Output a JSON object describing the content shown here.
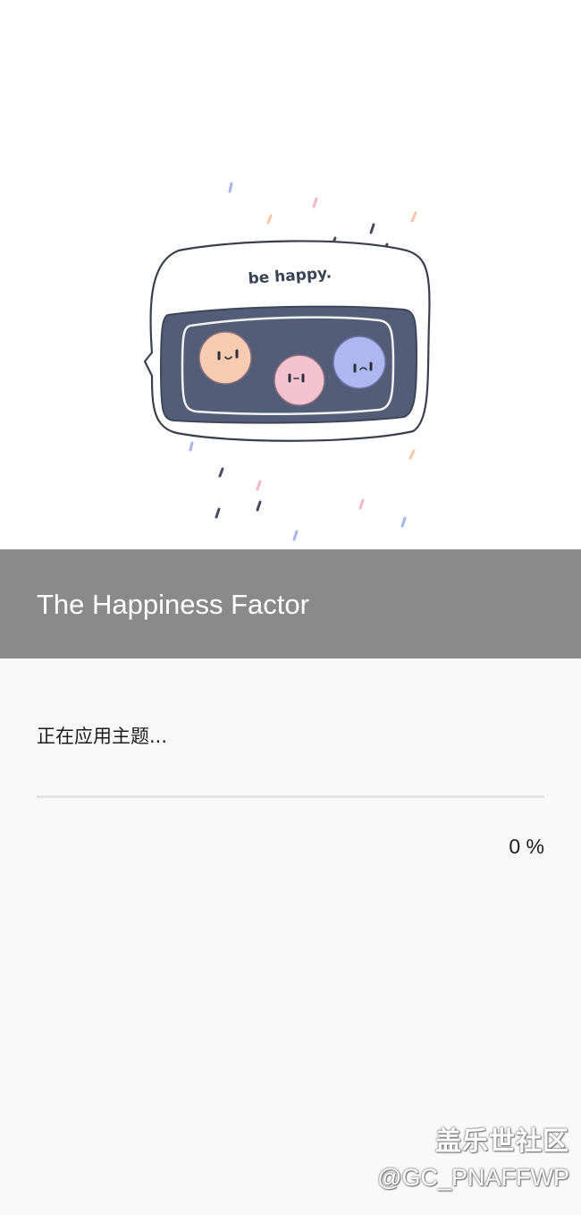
{
  "theme": {
    "title": "The Happiness Factor",
    "illustration_text": "be happy."
  },
  "apply": {
    "status": "正在应用主题...",
    "progress_percent": 0,
    "percent_label": "0 %"
  },
  "watermark": {
    "line1": "盖乐世社区",
    "line2": "@GC_PNAFFWP"
  },
  "colors": {
    "title_bar": "#8a8a8a",
    "page_background": "#f9f9f9",
    "preview_background": "#ffffff",
    "screen_navy": "#535d77",
    "face_peach": "#f6cbb1",
    "face_pink": "#f3c3d2",
    "face_blue": "#adb7f0"
  }
}
